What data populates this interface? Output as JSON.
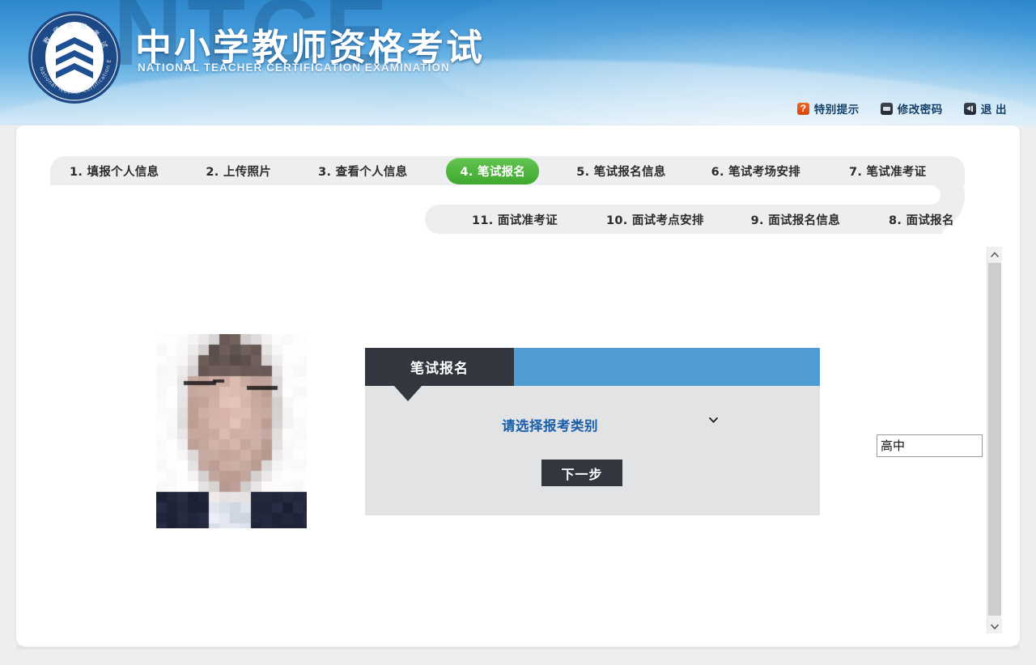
{
  "header": {
    "watermark": "NTCE",
    "title_cn": "中小学教师资格考试",
    "title_en": "NATIONAL TEACHER CERTIFICATION EXAMINATION",
    "logo_alt": "teacher-certification-emblem",
    "links": [
      {
        "label": "特别提示",
        "icon": "question-mark-icon"
      },
      {
        "label": "修改密码",
        "icon": "key-icon"
      },
      {
        "label": "退 出",
        "icon": "exit-arrow-icon"
      }
    ]
  },
  "steps": {
    "row1": [
      {
        "label": "1. 填报个人信息",
        "active": false
      },
      {
        "label": "2. 上传照片",
        "active": false
      },
      {
        "label": "3. 查看个人信息",
        "active": false
      },
      {
        "label": "4. 笔试报名",
        "active": true
      },
      {
        "label": "5. 笔试报名信息",
        "active": false
      },
      {
        "label": "6. 笔试考场安排",
        "active": false
      },
      {
        "label": "7. 笔试准考证",
        "active": false
      }
    ],
    "row2": [
      {
        "label": "11. 面试准考证",
        "active": false
      },
      {
        "label": "10. 面试考点安排",
        "active": false
      },
      {
        "label": "9. 面试报名信息",
        "active": false
      },
      {
        "label": "8. 面试报名",
        "active": false
      }
    ]
  },
  "photo": {
    "alt": "applicant-id-photo",
    "description": "pixelated portrait photo"
  },
  "form": {
    "tab_label": "笔试报名",
    "field_label": "请选择报考类别",
    "select_value": "高中",
    "select_options": [
      "高中"
    ],
    "next_button": "下一步"
  },
  "scrollbar": {
    "up_icon": "chevron-up-icon",
    "down_icon": "chevron-down-icon"
  },
  "colors": {
    "banner_blue": "#3f97d8",
    "active_step_green": "#3fa82f",
    "card_dark": "#32363f",
    "card_blue": "#4f9bd4",
    "label_blue": "#1a5fa8"
  }
}
